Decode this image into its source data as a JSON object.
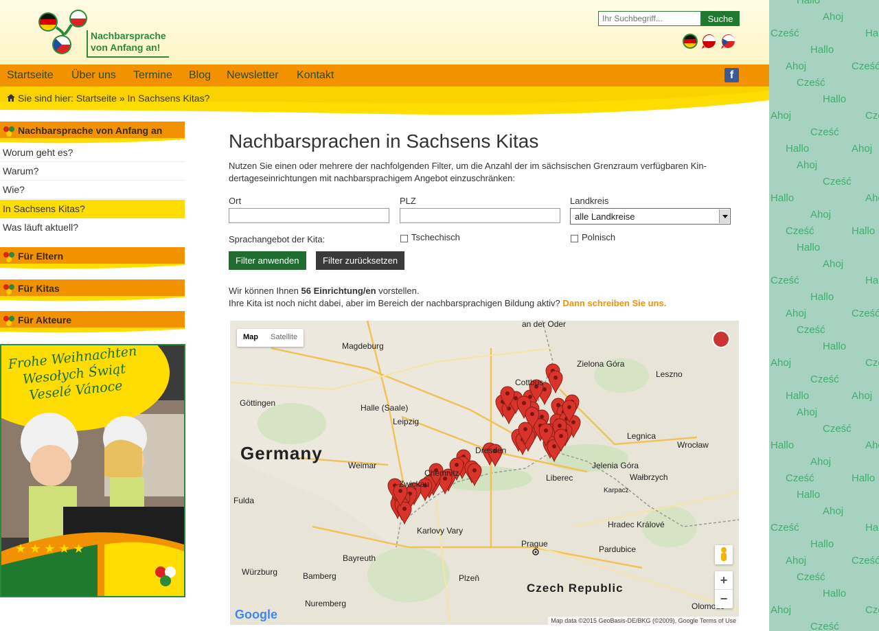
{
  "header": {
    "logo_line1": "Nachbarsprache",
    "logo_line2": "von Anfang an!",
    "search_placeholder": "Ihr Suchbegriff...",
    "search_button": "Suche",
    "languages": [
      "de-flag-icon",
      "pl-flag-icon",
      "cz-flag-icon"
    ]
  },
  "nav": {
    "items": [
      "Startseite",
      "Über uns",
      "Termine",
      "Blog",
      "Newsletter",
      "Kontakt"
    ],
    "facebook": "f"
  },
  "breadcrumb": {
    "prefix": "Sie sind hier:",
    "path": "Startseite » In Sachsens Kitas?"
  },
  "sidebar": {
    "section1_title": "Nachbarsprache von Anfang an",
    "items": [
      "Worum geht es?",
      "Warum?",
      "Wie?",
      "In Sachsens Kitas?",
      "Was läuft aktuell?"
    ],
    "section2_title": "Für Eltern",
    "section3_title": "Für Kitas",
    "section4_title": "Für Akteure",
    "banner_line1": "Frohe Weihnachten",
    "banner_line2": "Wesołych Świąt",
    "banner_line3": "Veselé Vánoce"
  },
  "main": {
    "title": "Nachbarsprachen in Sachsens Kitas",
    "intro": "Nutzen Sie einen oder mehrere der nachfolgenden Filter, um die Anzahl der im sächsischen Grenzraum verfügbaren Kin-dertageseinrichtungen mit nachbarsprachigem Angebot einzuschränken:",
    "ort_label": "Ort",
    "ort_value": "",
    "plz_label": "PLZ",
    "plz_value": "",
    "landkreis_label": "Landkreis",
    "landkreis_value": "alle Landkreise",
    "sprachangebot_label": "Sprachangebot der Kita:",
    "tschechisch": "Tschechisch",
    "polnisch": "Polnisch",
    "apply_button": "Filter anwenden",
    "reset_button": "Filter zurücksetzen",
    "result_pre": "Wir können Ihnen ",
    "result_count": "56 Einrichtung/en",
    "result_post": " vorstellen.",
    "result_line2": "Ihre Kita ist noch nicht dabei, aber im Bereich der nachbarsprachigen Bildung aktiv? ",
    "result_link": "Dann schreiben Sie uns."
  },
  "map": {
    "type_map": "Map",
    "type_satellite": "Satellite",
    "country_de": "Germany",
    "country_cz": "Czech Republic",
    "cities": [
      "Magdeburg",
      "Göttingen",
      "Halle (Saale)",
      "Leipzig",
      "Cottbus",
      "Zielona Góra",
      "Lesznо",
      "Dresden",
      "Legnica",
      "Wrocław",
      "Weimar",
      "Chemnitz",
      "Zwickau",
      "Jelenia Góra",
      "Wałbrzych",
      "Liberec",
      "Fulda",
      "Karlovy Vary",
      "Prague",
      "Hradec Králové",
      "Pardubice",
      "Bayreuth",
      "Würzburg",
      "Bamberg",
      "Plzeň",
      "Nuremberg",
      "Olomouc",
      "Karpacz",
      "an der Oder"
    ],
    "attribution": "Map data ©2015 GeoBasis-DE/BKG (©2009), Google   Terms of Use",
    "google": "Google",
    "zoom_in": "+",
    "zoom_out": "−"
  },
  "greetings": [
    "Hallo",
    "Ahoj",
    "Cześć"
  ],
  "colors": {
    "orange": "#f39200",
    "yellow": "#ffdd00",
    "green": "#1f7a30",
    "dark_button": "#3a3a3a",
    "marker": "#d9342b"
  }
}
